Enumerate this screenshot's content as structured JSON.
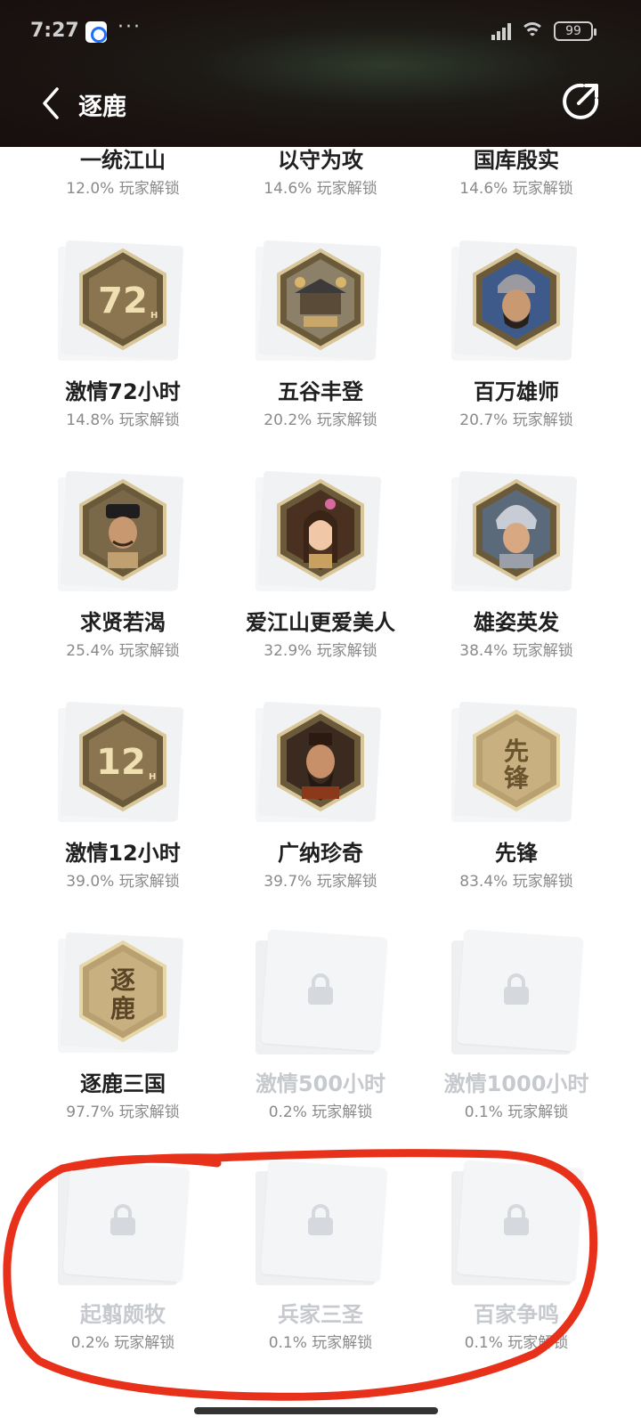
{
  "status_bar": {
    "time": "7:27",
    "dots": "···",
    "battery": "99"
  },
  "header": {
    "title": "逐鹿"
  },
  "achievements": [
    {
      "name": "一统江山",
      "percent": "12.0% 玩家解锁",
      "locked": false
    },
    {
      "name": "以守为攻",
      "percent": "14.6% 玩家解锁",
      "locked": false
    },
    {
      "name": "国库殷实",
      "percent": "14.6% 玩家解锁",
      "locked": false
    },
    {
      "name": "激情72小时",
      "percent": "14.8% 玩家解锁",
      "locked": false,
      "badge": "72"
    },
    {
      "name": "五谷丰登",
      "percent": "20.2% 玩家解锁",
      "locked": false,
      "badge": "building"
    },
    {
      "name": "百万雄师",
      "percent": "20.7% 玩家解锁",
      "locked": false,
      "badge": "general"
    },
    {
      "name": "求贤若渴",
      "percent": "25.4% 玩家解锁",
      "locked": false,
      "badge": "scholar"
    },
    {
      "name": "爱江山更爱美人",
      "percent": "32.9% 玩家解锁",
      "locked": false,
      "badge": "lady"
    },
    {
      "name": "雄姿英发",
      "percent": "38.4% 玩家解锁",
      "locked": false,
      "badge": "warrior"
    },
    {
      "name": "激情12小时",
      "percent": "39.0% 玩家解锁",
      "locked": false,
      "badge": "12"
    },
    {
      "name": "广纳珍奇",
      "percent": "39.7% 玩家解锁",
      "locked": false,
      "badge": "lord"
    },
    {
      "name": "先锋",
      "percent": "83.4% 玩家解锁",
      "locked": false,
      "badge": "text",
      "badge_text": "先锋"
    },
    {
      "name": "逐鹿三国",
      "percent": "97.7% 玩家解锁",
      "locked": false,
      "badge": "text",
      "badge_text": "逐鹿"
    },
    {
      "name": "激情500小时",
      "percent": "0.2% 玩家解锁",
      "locked": true
    },
    {
      "name": "激情1000小时",
      "percent": "0.1% 玩家解锁",
      "locked": true
    },
    {
      "name": "起翦颇牧",
      "percent": "0.2% 玩家解锁",
      "locked": true
    },
    {
      "name": "兵家三圣",
      "percent": "0.1% 玩家解锁",
      "locked": true
    },
    {
      "name": "百家争鸣",
      "percent": "0.1% 玩家解锁",
      "locked": true
    }
  ],
  "colors": {
    "header_bg": "#1a1210",
    "badge_gold": "#a08a5c",
    "annotation": "#e8311a"
  }
}
